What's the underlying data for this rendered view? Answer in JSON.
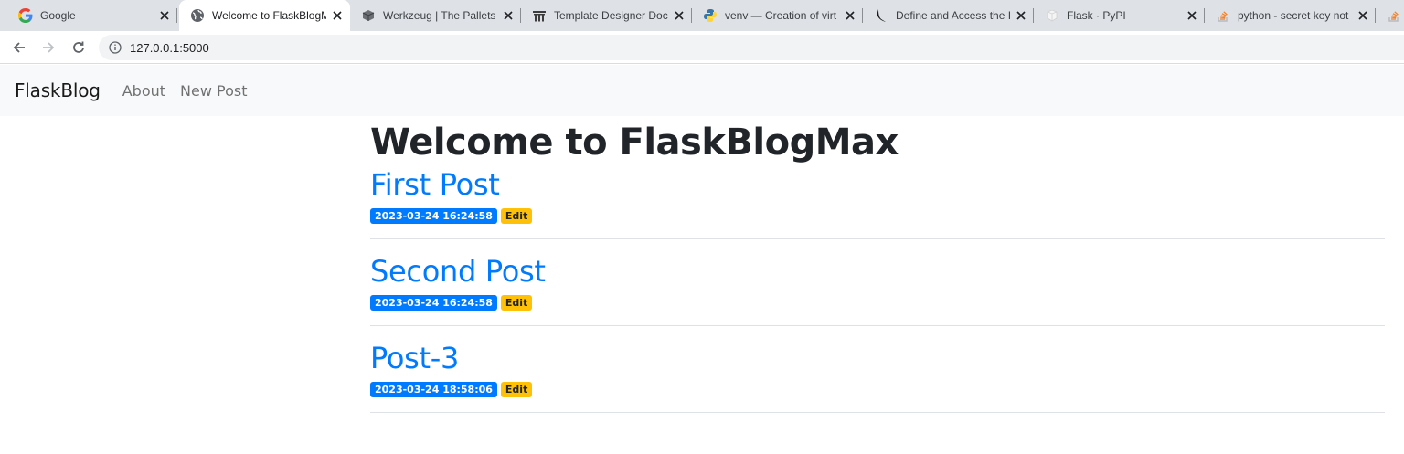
{
  "browser": {
    "tabs": [
      {
        "title": "Google",
        "icon": "google-icon",
        "active": false
      },
      {
        "title": "Welcome to FlaskBlogM",
        "icon": "globe-icon",
        "active": true
      },
      {
        "title": "Werkzeug | The Pallets",
        "icon": "werkzeug-icon",
        "active": false
      },
      {
        "title": "Template Designer Doc",
        "icon": "jinja-icon",
        "active": false
      },
      {
        "title": "venv — Creation of virt",
        "icon": "python-icon",
        "active": false
      },
      {
        "title": "Define and Access the I",
        "icon": "flask-icon",
        "active": false
      },
      {
        "title": "Flask · PyPI",
        "icon": "pypi-icon",
        "active": false
      },
      {
        "title": "python - secret key not",
        "icon": "stackoverflow-icon",
        "active": false
      }
    ],
    "url": "127.0.0.1:5000"
  },
  "navbar": {
    "brand": "FlaskBlog",
    "links": [
      "About",
      "New Post"
    ]
  },
  "main": {
    "heading": "Welcome to FlaskBlogMax",
    "posts": [
      {
        "title": "First Post",
        "date": "2023-03-24 16:24:58",
        "edit_label": "Edit"
      },
      {
        "title": "Second Post",
        "date": "2023-03-24 16:24:58",
        "edit_label": "Edit"
      },
      {
        "title": "Post-3",
        "date": "2023-03-24 18:58:06",
        "edit_label": "Edit"
      }
    ]
  },
  "colors": {
    "primary": "#007bff",
    "warning": "#ffc107",
    "navbar_bg": "#f8f9fa",
    "tabstrip_bg": "#dee1e6"
  }
}
